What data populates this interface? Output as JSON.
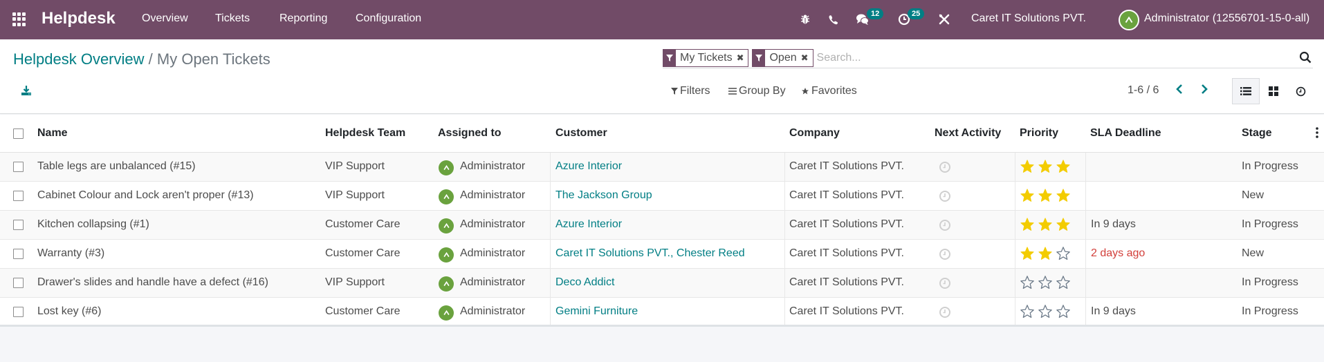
{
  "navbar": {
    "brand": "Helpdesk",
    "menu": [
      "Overview",
      "Tickets",
      "Reporting",
      "Configuration"
    ],
    "icons": [
      "bug-icon",
      "phone-icon",
      "chat-icon",
      "activity-clock-icon",
      "tools-icon"
    ],
    "messages_count": "12",
    "activities_count": "25",
    "company": "Caret IT Solutions PVT.",
    "user": "Administrator (12556701-15-0-all)"
  },
  "breadcrumb": {
    "parent": "Helpdesk Overview",
    "separator": "/",
    "current": "My Open Tickets"
  },
  "search": {
    "facets": [
      {
        "label": "My Tickets",
        "icon": "filter-icon"
      },
      {
        "label": "Open",
        "icon": "filter-icon"
      }
    ],
    "placeholder": "Search..."
  },
  "toolbar": {
    "filters": "Filters",
    "group_by": "Group By",
    "favorites": "Favorites",
    "pager": "1-6 / 6"
  },
  "colors": {
    "brand": "#714b67",
    "link": "#017e84",
    "badge": "#017e84",
    "star": "#f3cc00",
    "danger": "#d23f3a",
    "avatar": "#6aa23e"
  },
  "table": {
    "headers": [
      "Name",
      "Helpdesk Team",
      "Assigned to",
      "Customer",
      "Company",
      "Next Activity",
      "Priority",
      "SLA Deadline",
      "Stage"
    ],
    "rows": [
      {
        "name": "Table legs are unbalanced (#15)",
        "team": "VIP Support",
        "assigned": "Administrator",
        "customer": "Azure Interior",
        "company": "Caret IT Solutions PVT.",
        "priority": 3,
        "sla": "",
        "sla_overdue": false,
        "stage": "In Progress"
      },
      {
        "name": "Cabinet Colour and Lock aren't proper (#13)",
        "team": "VIP Support",
        "assigned": "Administrator",
        "customer": "The Jackson Group",
        "company": "Caret IT Solutions PVT.",
        "priority": 3,
        "sla": "",
        "sla_overdue": false,
        "stage": "New"
      },
      {
        "name": "Kitchen collapsing (#1)",
        "team": "Customer Care",
        "assigned": "Administrator",
        "customer": "Azure Interior",
        "company": "Caret IT Solutions PVT.",
        "priority": 3,
        "sla": "In 9 days",
        "sla_overdue": false,
        "stage": "In Progress"
      },
      {
        "name": "Warranty (#3)",
        "team": "Customer Care",
        "assigned": "Administrator",
        "customer": "Caret IT Solutions PVT., Chester Reed",
        "company": "Caret IT Solutions PVT.",
        "priority": 2,
        "sla": "2 days ago",
        "sla_overdue": true,
        "stage": "New"
      },
      {
        "name": "Drawer's slides and handle have a defect (#16)",
        "team": "VIP Support",
        "assigned": "Administrator",
        "customer": "Deco Addict",
        "company": "Caret IT Solutions PVT.",
        "priority": 0,
        "sla": "",
        "sla_overdue": false,
        "stage": "In Progress"
      },
      {
        "name": "Lost key (#6)",
        "team": "Customer Care",
        "assigned": "Administrator",
        "customer": "Gemini Furniture",
        "company": "Caret IT Solutions PVT.",
        "priority": 0,
        "sla": "In 9 days",
        "sla_overdue": false,
        "stage": "In Progress"
      }
    ]
  }
}
